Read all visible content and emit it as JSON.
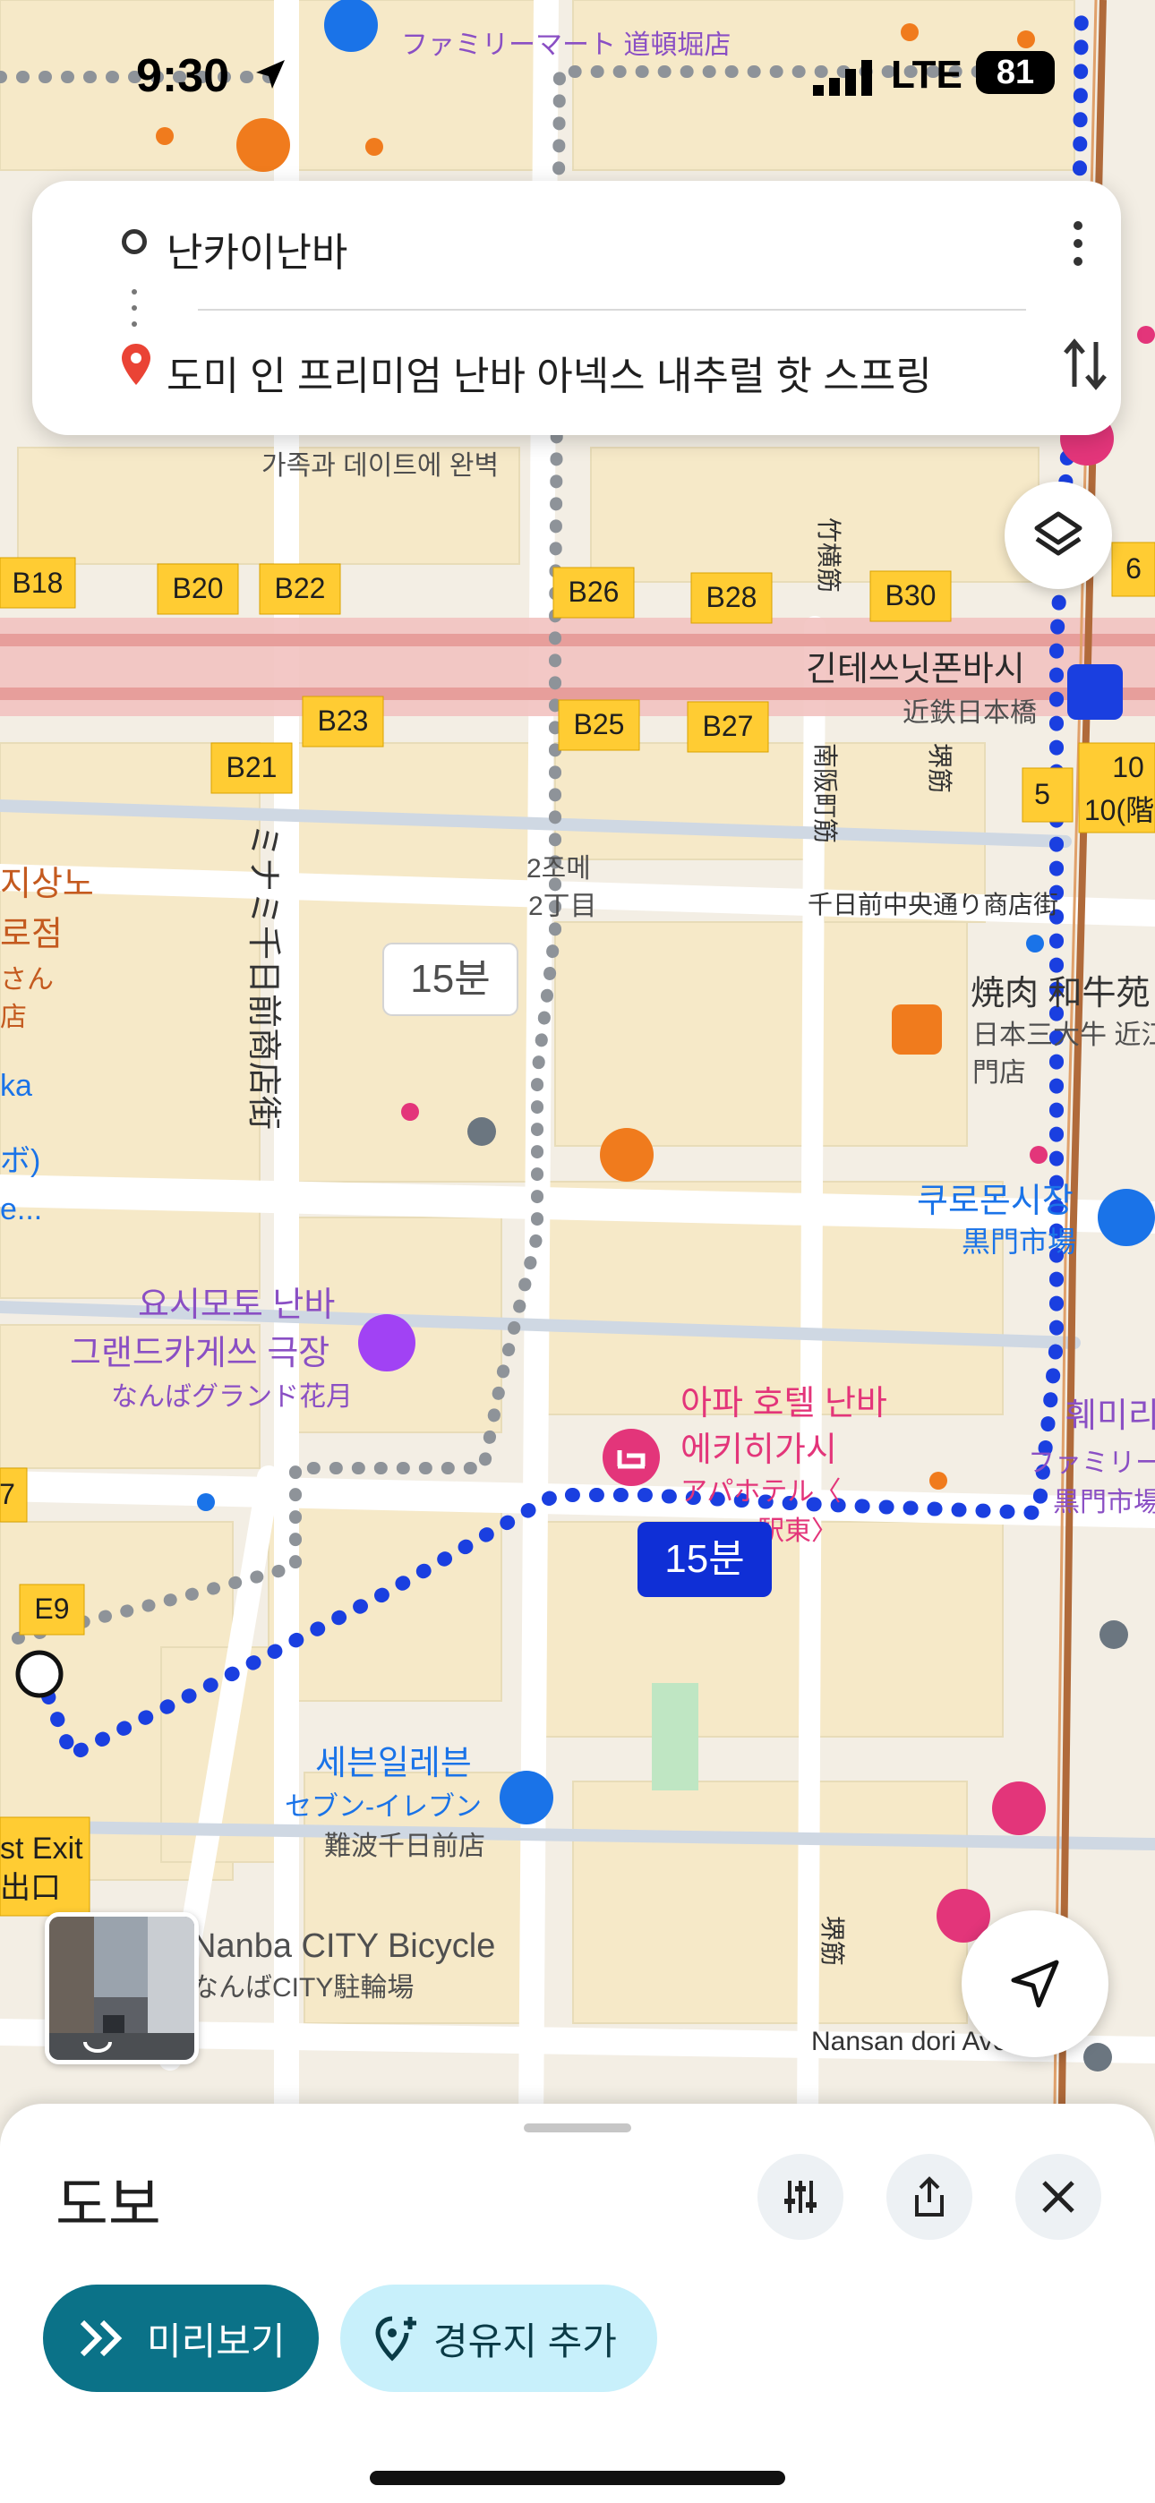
{
  "status_bar": {
    "time": "9:30",
    "network": "LTE",
    "battery": "81"
  },
  "route_search": {
    "origin": "난카이난바",
    "destination": "도미 인 프리미엄 난바 아넥스 내추럴 핫 스프링"
  },
  "map": {
    "route_time_badge": "15분",
    "alt_route_time_badge": "15분",
    "gates": [
      "B18",
      "B20",
      "B22",
      "B26",
      "B28",
      "B30",
      "B23",
      "B25",
      "B27",
      "B21",
      "E9",
      "5",
      "6",
      "10",
      "10(階"
    ],
    "pois": {
      "family_mart_top": "ファミリーマート 道頓堀店",
      "family_mart_top_ko": "훼미리마트",
      "family_date": "가족과 데이트에 완벽",
      "kintetsu_station_ko": "긴테쓰닛폰바시",
      "kintetsu_station_ja": "近鉄日本橋",
      "nanbacho": "南阪町筋",
      "sakaisuji": "堺筋",
      "takeyokosuji": "竹横筋",
      "chome_ko": "2조메",
      "chome_ja": "2丁目",
      "sennichimae_street": "千日前中央通り商店街",
      "yakiniku": "焼肉 和牛苑",
      "yakiniku_sub1": "日本三大牛 近江",
      "yakiniku_sub2": "門店",
      "kuromon_ko": "쿠로몬시장",
      "kuromon_ja": "黒門市場",
      "yoshimoto_ko1": "요시모토 난바",
      "yoshimoto_ko2": "그랜드카게쓰 극장",
      "yoshimoto_ja": "なんばグランド花月",
      "apa_ko1": "아파 호텔 난바",
      "apa_ko2": "에키히가시",
      "apa_ja1": "アパホテル〈",
      "apa_ja2": "駅東〉",
      "family_mart_right_ko": "훼미리",
      "family_mart_right_ja1": "ファミリー",
      "family_mart_right_ja2": "黒門市場",
      "seven_ko": "세븐일레븐",
      "seven_ja1": "セブン-イレブン",
      "seven_ja2": "難波千日前店",
      "bicycle_en": "Nanba CITY Bicycle",
      "bicycle_ja": "なんばCITY駐輪場",
      "nansan": "Nansan dori Ave",
      "sennichimae_shotengai": "ミナミ千日前商店街",
      "left_label1": "지상노",
      "left_label2": "로점",
      "left_label3": "さん",
      "left_label4": "店",
      "left_label5": "ka",
      "left_label6": "ボ)",
      "left_label7": "e...",
      "exit_label1": "st Exit",
      "exit_label2": "出口",
      "sakaisuji2": "堺筋",
      "e7": "7"
    }
  },
  "bottom_sheet": {
    "mode_title": "도보",
    "preview_label": "미리보기",
    "add_stop_label": "경유지 추가"
  },
  "colors": {
    "route_blue": "#1a3fe0",
    "alt_route_gray": "#8e9399",
    "preview_bg": "#0b7288",
    "add_stop_bg": "#c8f0fb",
    "rail_pink": "#f2b8b6",
    "gate_yellow": "#ffcc33",
    "poi_pink": "#e3357a",
    "poi_orange": "#f07b1d"
  },
  "icons": [
    "location-arrow-icon",
    "signal-icon",
    "more-vert-icon",
    "swap-icon",
    "pin-icon",
    "layers-icon",
    "navigation-arrow-icon",
    "tune-icon",
    "share-icon",
    "close-icon",
    "double-chevron-icon",
    "add-location-icon",
    "restaurant-icon",
    "hotel-icon",
    "convenience-store-icon",
    "bicycle-icon",
    "metro-icon",
    "theater-icon"
  ]
}
